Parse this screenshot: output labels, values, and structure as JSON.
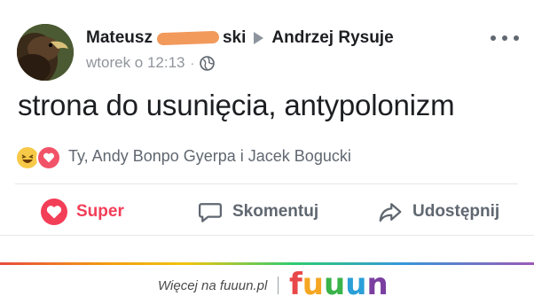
{
  "post": {
    "author_first": "Mateusz",
    "author_last_visible": "ski",
    "target": "Andrzej Rysuje",
    "timestamp": "wtorek o 12:13",
    "meta_separator": "·",
    "privacy_icon": "globe-icon",
    "text": "strona do usunięcia, antypolonizm"
  },
  "reactions": {
    "icons": [
      "haha-emoji-icon",
      "love-reaction-icon"
    ],
    "names": "Ty, Andy Bonpo Gyerpa i Jacek Bogucki"
  },
  "actions": {
    "love_label": "Super",
    "comment_label": "Skomentuj",
    "share_label": "Udostępnij"
  },
  "footer": {
    "link_text": "Więcej na fuuun.pl",
    "logo_letters": [
      "f",
      "u",
      "u",
      "u",
      "n"
    ]
  },
  "colors": {
    "love_red": "#f33e58",
    "redaction_orange": "#f29a5c",
    "logo": [
      "#e8484a",
      "#f5a623",
      "#3ab34a",
      "#2a9fd8",
      "#7b3fa0"
    ]
  }
}
